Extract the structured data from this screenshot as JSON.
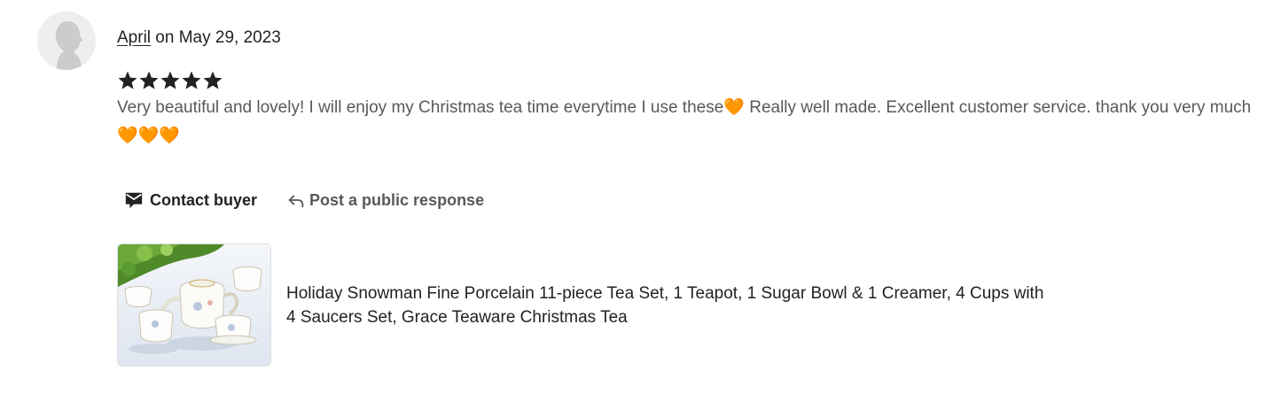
{
  "review": {
    "reviewer_name": "April",
    "date_text": " on May 29, 2023",
    "rating": 5,
    "rating_max": 5,
    "text": "Very beautiful and lovely! I will enjoy my Christmas tea time everytime I use these🧡 Really well made. Excellent customer service. thank you very much🧡🧡🧡"
  },
  "actions": {
    "contact_label": "Contact buyer",
    "contact_icon": "envelope-icon",
    "respond_label": "Post a public response",
    "respond_icon": "reply-arrow-icon"
  },
  "product": {
    "title": "Holiday Snowman Fine Porcelain 11-piece Tea Set, 1 Teapot, 1 Sugar Bowl & 1 Creamer, 4 Cups with 4 Saucers Set, Grace Teaware Christmas Tea"
  },
  "colors": {
    "text_primary": "#222222",
    "text_secondary": "#595959",
    "star": "#222222",
    "avatar_bg": "#eeeeee"
  }
}
